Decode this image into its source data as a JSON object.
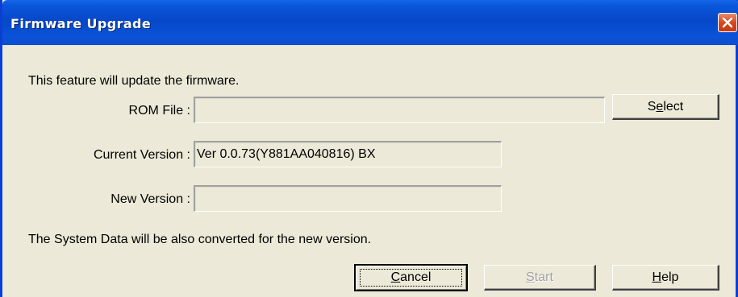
{
  "window": {
    "title": "Firmware Upgrade"
  },
  "intro_text": "This feature will update the firmware.",
  "rom_file": {
    "label": "ROM File :",
    "value": ""
  },
  "current_version": {
    "label": "Current Version :",
    "value": "Ver 0.0.73(Y881AA040816) BX"
  },
  "new_version": {
    "label": "New Version :",
    "value": ""
  },
  "note_text": "The System Data will be also converted for the new version.",
  "buttons": {
    "select": {
      "pre": "S",
      "accel": "e",
      "post": "lect"
    },
    "cancel": {
      "pre": "",
      "accel": "C",
      "post": "ancel"
    },
    "start": {
      "pre": "",
      "accel": "S",
      "post": "tart"
    },
    "help": {
      "pre": "",
      "accel": "H",
      "post": "elp"
    }
  },
  "icons": {
    "close": "close-icon"
  },
  "colors": {
    "titlebar": "#0648c8",
    "close_button": "#d6491f",
    "window_bg": "#ece9d8"
  }
}
